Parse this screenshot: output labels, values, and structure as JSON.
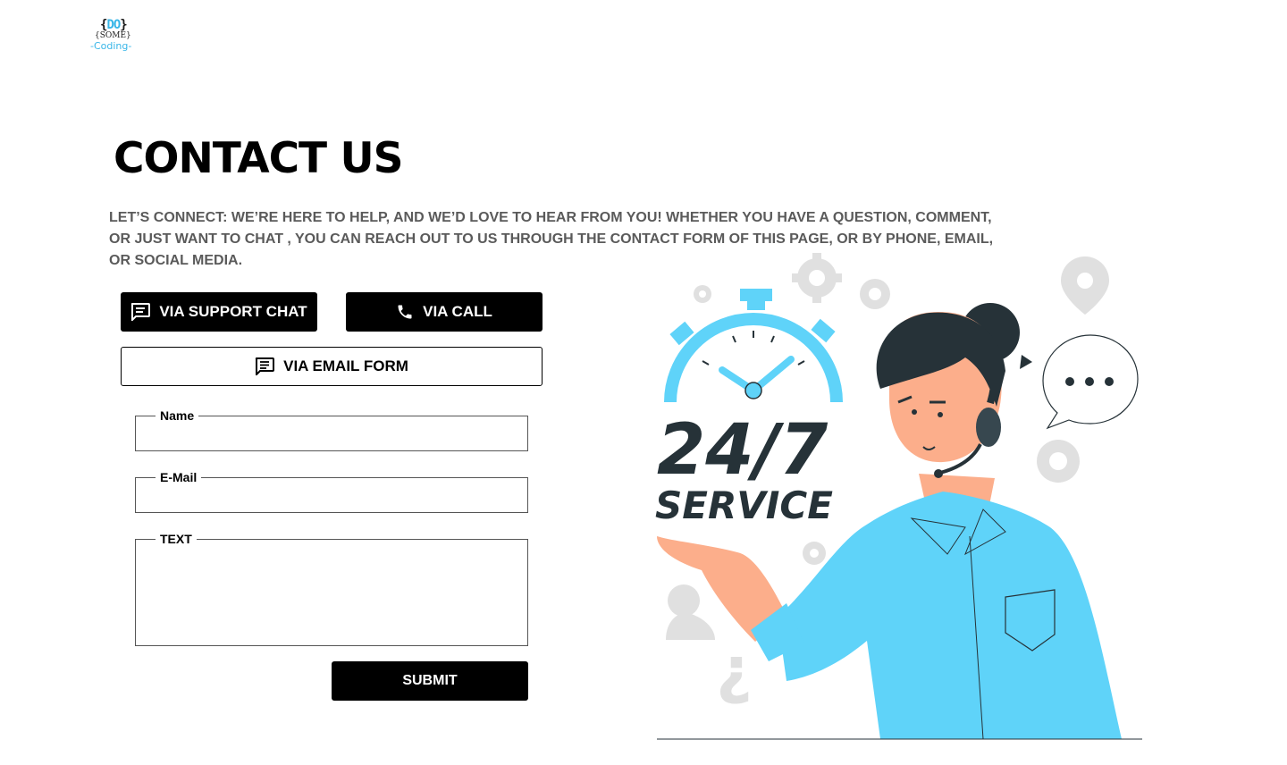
{
  "logo": {
    "line1_open": "{",
    "line1_do": "DO",
    "line1_close": "}",
    "line2": "{SOME}",
    "line3": "-Coding-"
  },
  "page_title": "CONTACT US",
  "intro_text": "LET’S CONNECT: WE’RE HERE TO HELP, AND WE’D LOVE TO HEAR FROM YOU! WHETHER YOU HAVE A QUESTION, COMMENT, OR JUST WANT TO CHAT , YOU CAN REACH OUT TO US THROUGH THE CONTACT FORM OF THIS PAGE, OR BY PHONE, EMAIL, OR SOCIAL MEDIA.",
  "contact_options": {
    "chat_label": "VIA SUPPORT CHAT",
    "call_label": "VIA CALL",
    "email_label": "VIA EMAIL FORM"
  },
  "form": {
    "name_label": "Name",
    "name_value": "",
    "email_label": "E-Mail",
    "email_value": "",
    "text_label": "TEXT",
    "text_value": "",
    "submit_label": "SUBMIT"
  },
  "illustration": {
    "headline": "24/7",
    "subheadline": "SERVICE"
  },
  "colors": {
    "accent": "#5fd3f9",
    "dark_text": "#263238",
    "button_bg": "#000000"
  }
}
